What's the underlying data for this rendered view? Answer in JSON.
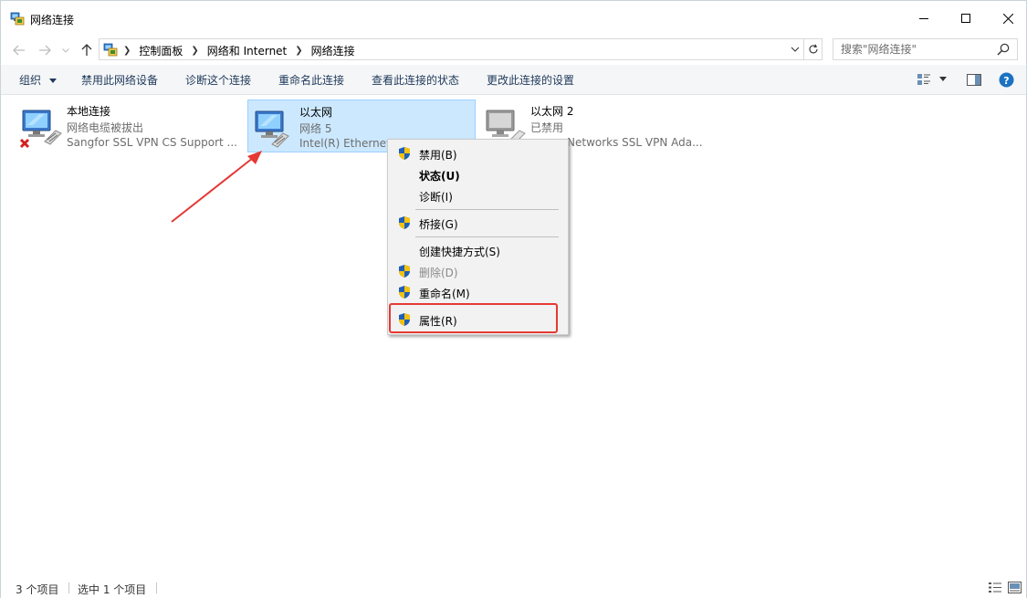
{
  "window": {
    "title": "网络连接"
  },
  "address": {
    "crumbs": [
      "控制面板",
      "网络和 Internet",
      "网络连接"
    ]
  },
  "search": {
    "placeholder": "搜索\"网络连接\""
  },
  "commands": {
    "organize": "组织",
    "disable_device": "禁用此网络设备",
    "diagnose": "诊断这个连接",
    "rename": "重命名此连接",
    "view_status": "查看此连接的状态",
    "change_settings": "更改此连接的设置"
  },
  "connections": [
    {
      "name": "本地连接",
      "status": "网络电缆被拔出",
      "device": "Sangfor SSL VPN CS Support ...",
      "icon": "network-disconnected-icon"
    },
    {
      "name": "以太网",
      "status": "网络 5",
      "device": "Intel(R) Ethernet",
      "icon": "network-connected-icon",
      "selected": true
    },
    {
      "name": "以太网 2",
      "status": "已禁用",
      "device": "Networks SSL VPN Ada...",
      "icon": "network-disabled-icon"
    }
  ],
  "context_menu": {
    "items": [
      {
        "label": "禁用(B)",
        "shield": true
      },
      {
        "label": "状态(U)",
        "bold": true
      },
      {
        "label": "诊断(I)"
      },
      {
        "label": "桥接(G)",
        "shield": true
      },
      {
        "label": "创建快捷方式(S)"
      },
      {
        "label": "删除(D)",
        "shield": true,
        "disabled": true
      },
      {
        "label": "重命名(M)",
        "shield": true
      },
      {
        "label": "属性(R)",
        "shield": true,
        "highlighted": true
      }
    ]
  },
  "statusbar": {
    "item_count": "3 个项目",
    "selected_count": "选中 1 个项目"
  },
  "colors": {
    "selection_bg": "#cce8ff",
    "selection_border": "#99d1ff",
    "highlight_red": "#e53935",
    "command_text": "#1e395b",
    "help_blue": "#1b72c2"
  }
}
